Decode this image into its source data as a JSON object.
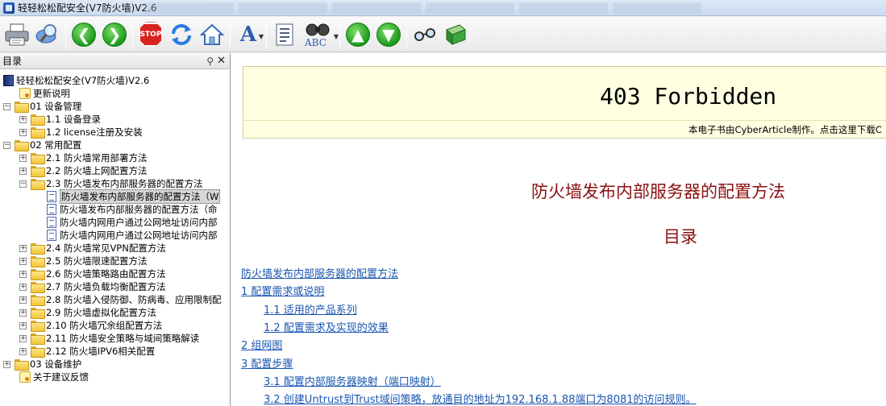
{
  "window": {
    "title": "轻轻松松配安全(V7防火墙)V2.6"
  },
  "toolbar": {
    "icons": [
      "print-icon",
      "search-icon",
      "back-icon",
      "forward-icon",
      "stop-icon",
      "refresh-icon",
      "home-icon",
      "font-icon",
      "notes-icon",
      "find-icon",
      "up-icon",
      "down-icon",
      "glasses-icon",
      "book-icon"
    ],
    "stop_label": "STOP",
    "font_label": "A",
    "find_label": "ABC"
  },
  "left_panel": {
    "title": "目录",
    "tree": [
      {
        "label": "轻轻松松配安全(V7防火墙)V2.6",
        "level": 0,
        "type": "book"
      },
      {
        "label": "更新说明",
        "level": 1,
        "type": "note"
      },
      {
        "label": "01 设备管理",
        "level": 0,
        "type": "folder",
        "expanded": true
      },
      {
        "label": "1.1 设备登录",
        "level": 1,
        "type": "folder",
        "expanded": false
      },
      {
        "label": "1.2 license注册及安装",
        "level": 1,
        "type": "folder",
        "expanded": false
      },
      {
        "label": "02 常用配置",
        "level": 0,
        "type": "folder",
        "expanded": true
      },
      {
        "label": "2.1 防火墙常用部署方法",
        "level": 1,
        "type": "folder",
        "expanded": false
      },
      {
        "label": "2.2 防火墙上网配置方法",
        "level": 1,
        "type": "folder",
        "expanded": false
      },
      {
        "label": "2.3 防火墙发布内部服务器的配置方法",
        "level": 1,
        "type": "folder",
        "expanded": true
      },
      {
        "label": "防火墙发布内部服务器的配置方法（W",
        "level": 2,
        "type": "page",
        "selected": true
      },
      {
        "label": "防火墙发布内部服务器的配置方法（命",
        "level": 2,
        "type": "page"
      },
      {
        "label": "防火墙内网用户通过公网地址访问内部",
        "level": 2,
        "type": "page"
      },
      {
        "label": "防火墙内网用户通过公网地址访问内部",
        "level": 2,
        "type": "page"
      },
      {
        "label": "2.4 防火墙常见VPN配置方法",
        "level": 1,
        "type": "folder",
        "expanded": false
      },
      {
        "label": "2.5 防火墙限速配置方法",
        "level": 1,
        "type": "folder",
        "expanded": false
      },
      {
        "label": "2.6 防火墙策略路由配置方法",
        "level": 1,
        "type": "folder",
        "expanded": false
      },
      {
        "label": "2.7 防火墙负载均衡配置方法",
        "level": 1,
        "type": "folder",
        "expanded": false
      },
      {
        "label": "2.8 防火墙入侵防御、防病毒、应用限制配",
        "level": 1,
        "type": "folder",
        "expanded": false
      },
      {
        "label": "2.9 防火墙虚拟化配置方法",
        "level": 1,
        "type": "folder",
        "expanded": false
      },
      {
        "label": "2.10 防火墙冗余组配置方法",
        "level": 1,
        "type": "folder",
        "expanded": false
      },
      {
        "label": "2.11 防火墙安全策略与域间策略解读",
        "level": 1,
        "type": "folder",
        "expanded": false
      },
      {
        "label": "2.12 防火墙IPV6相关配置",
        "level": 1,
        "type": "folder",
        "expanded": false
      },
      {
        "label": "03 设备维护",
        "level": 0,
        "type": "folder",
        "expanded": false
      },
      {
        "label": "关于建议反馈",
        "level": 0,
        "type": "note"
      }
    ]
  },
  "content": {
    "banner_heading": "403 Forbidden",
    "banner_note": "本电子书由CyberArticle制作。点击这里下载C",
    "doc_title": "防火墙发布内部服务器的配置方法",
    "toc_title": "目录",
    "toc": [
      {
        "label": "防火墙发布内部服务器的配置方法",
        "indent": 0
      },
      {
        "label": "1 配置需求或说明",
        "indent": 0
      },
      {
        "label": "1.1 适用的产品系列",
        "indent": 1
      },
      {
        "label": "1.2 配置需求及实现的效果",
        "indent": 1
      },
      {
        "label": "2 组网图",
        "indent": 0
      },
      {
        "label": "3 配置步骤",
        "indent": 0
      },
      {
        "label": "3.1 配置内部服务器映射（端口映射）",
        "indent": 1
      },
      {
        "label": "3.2 创建Untrust到Trust域间策略，放通目的地址为192.168.1.88端口为8081的访问规则。",
        "indent": 1
      }
    ]
  }
}
